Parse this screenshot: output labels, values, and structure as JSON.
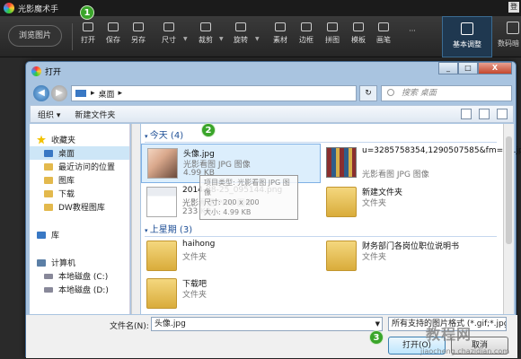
{
  "app": {
    "title": "光影魔术手",
    "browse_label": "浏览图片",
    "tools": [
      "打开",
      "保存",
      "另存",
      "尺寸",
      "裁剪",
      "旋转",
      "素材",
      "边框",
      "拼图",
      "模板",
      "画笔"
    ],
    "more": "···",
    "tab_basic": "基本调整",
    "tab_digital": "数码暗"
  },
  "badges": [
    "1",
    "2",
    "3"
  ],
  "dialog": {
    "title": "打开",
    "close_label": "X",
    "address": "桌面",
    "address_arrow": "▸",
    "search_placeholder": "搜索 桌面",
    "organize": "组织 ▾",
    "new_folder": "新建文件夹",
    "nav": {
      "favorites_header": "收藏夹",
      "favorites": [
        "桌面",
        "最近访问的位置",
        "图库",
        "下载",
        "DW教程图库"
      ],
      "library": "库",
      "computer": "计算机",
      "disks": [
        "本地磁盘 (C:)",
        "本地磁盘 (D:)"
      ]
    },
    "groups": {
      "today": "今天 (4)",
      "last_week": "上星期 (3)"
    },
    "files": [
      {
        "name": "头像.jpg",
        "type": "光影看图 JPG 图像",
        "size": "4.99 KB"
      },
      {
        "name": "u=3285758354,1290507585&fm=58.jpg",
        "type": "光影看图 JPG 图像",
        "size": ""
      },
      {
        "name": "2014-08-25_095144.png",
        "type": "光影看图 PNG 图像",
        "size": "233 KB"
      },
      {
        "name": "新建文件夹",
        "type": "文件夹",
        "size": ""
      },
      {
        "name": "haihong",
        "type": "文件夹",
        "size": ""
      },
      {
        "name": "财务部门各岗位职位说明书",
        "type": "文件夹",
        "size": ""
      },
      {
        "name": "下载吧",
        "type": "文件夹",
        "size": ""
      }
    ],
    "tooltip": [
      "项目类型: 光影看图 JPG 图像",
      "尺寸: 200 x 200",
      "大小: 4.99 KB"
    ],
    "filename_label": "文件名(N):",
    "filename_value": "头像.jpg",
    "filetype": "所有支持的图片格式 (*.gif;*.jpg",
    "open_label": "打开(O)",
    "cancel_label": "取消"
  },
  "watermark": {
    "main": "教程网",
    "url": "jiaocheng.chazidian.com"
  }
}
